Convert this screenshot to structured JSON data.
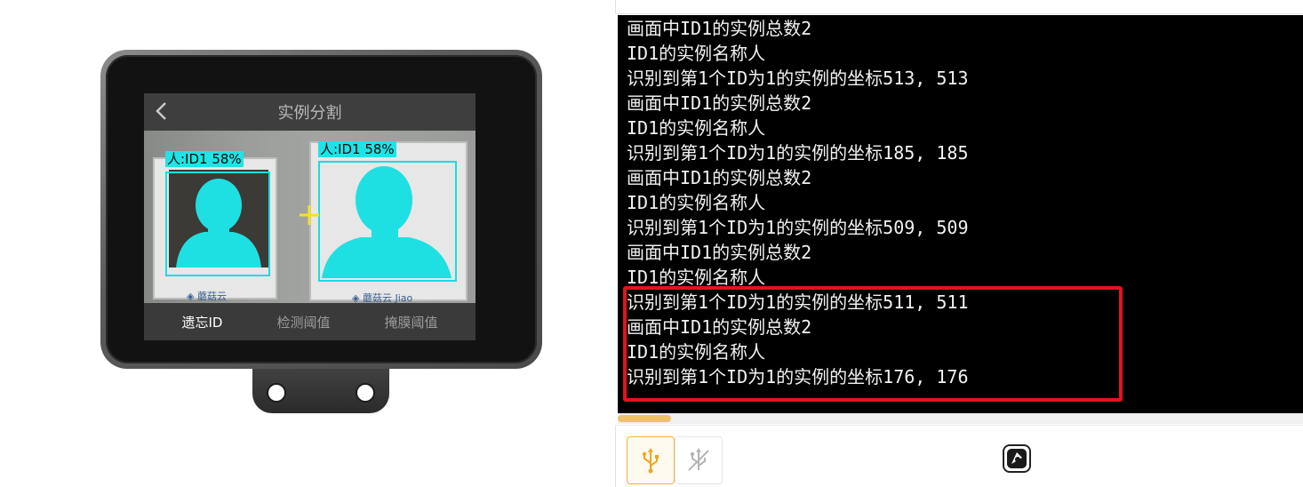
{
  "device": {
    "screen_title": "实例分割",
    "detections": [
      {
        "label": "人:ID1 58%"
      },
      {
        "label": "人:ID1 58%"
      }
    ],
    "card_logos": [
      "◈ 蘑菇云",
      "◈ 蘑菇云 Jiao"
    ],
    "bottom_buttons": [
      {
        "label": "遗忘ID",
        "active": true
      },
      {
        "label": "检测阈值",
        "active": false
      },
      {
        "label": "掩膜阈值",
        "active": false
      }
    ],
    "colors": {
      "detection": "#1fe3e6",
      "crosshair": "#f5e12a"
    }
  },
  "console": {
    "lines": [
      "画面中ID1的实例总数2",
      "ID1的实例名称人",
      "识别到第1个ID为1的实例的坐标513, 513",
      "画面中ID1的实例总数2",
      "ID1的实例名称人",
      "识别到第1个ID为1的实例的坐标185, 185",
      "画面中ID1的实例总数2",
      "ID1的实例名称人",
      "识别到第1个ID为1的实例的坐标509, 509",
      "画面中ID1的实例总数2",
      "ID1的实例名称人",
      "识别到第1个ID为1的实例的坐标511, 511",
      "画面中ID1的实例总数2",
      "ID1的实例名称人",
      "识别到第1个ID为1的实例的坐标176, 176"
    ],
    "highlight_color": "#e3141d"
  },
  "toolbar": {
    "icons": [
      "usb-connected-icon",
      "usb-disconnected-icon",
      "settings-icon"
    ],
    "accent": "#f2b441"
  }
}
